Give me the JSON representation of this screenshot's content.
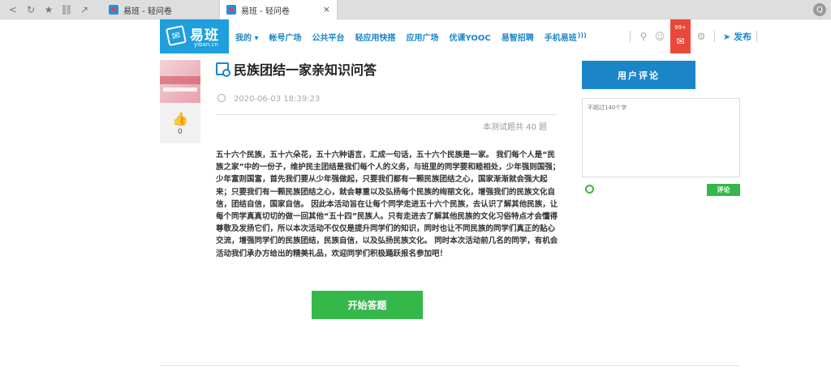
{
  "browser": {
    "tabs": [
      {
        "label": "易班 - 轻问卷"
      },
      {
        "label": "易班 - 轻问卷"
      }
    ],
    "nav_glyphs": {
      "back": "<",
      "refresh": "↻",
      "bookmark": "★",
      "link": "⛓",
      "share": "↗"
    },
    "close_glyph": "×",
    "menu_glyph": "Q"
  },
  "header": {
    "logo": {
      "name": "易班",
      "url": "yiban.cn"
    },
    "nav": [
      "我的 ▾",
      "帐号广场",
      "公共平台",
      "轻应用快搭",
      "应用广场",
      "优课YOOC",
      "易智招聘",
      "手机易班"
    ],
    "mail_badge": "99+",
    "publish_label": "发布"
  },
  "left": {
    "like_count": "0"
  },
  "main": {
    "title": "民族团结一家亲知识问答",
    "date": "2020-06-03 18:39:23",
    "question_count": "本测试题共 40 题",
    "description": "五十六个民族，五十六朵花，五十六种语言，汇成一句话，五十六个民族是一家。 我们每个人是“民族之家”中的一份子，维护民主团结是我们每个人的义务，与班里的同学要和睦相处，少年强则国强；少年富则国富，首先我们要从少年强做起，只要我们都有一颗民族团结之心，国家渐渐就会强大起来；只要我们有一颗民族团结之心，就会尊重以及弘扬每个民族的绚丽文化，增强我们的民族文化自信，团结自信，国家自信。 因此本活动旨在让每个同学走进五十六个民族，去认识了解其他民族，让每个同学真真切切的做一回其他“五十四”民族人。只有走进去了解其他民族的文化习俗特点才会懂得尊敬及发扬它们，所以本次活动不仅仅是提升同学们的知识，同时也让不同民族的同学们真正的贴心交流，增强同学们的民族团结，民族自信，以及弘扬民族文化。 同时本次活动前几名的同学，有机会活动我们承办方给出的精美礼品，欢迎同学们积极踊跃报名参加吧！",
    "start_button": "开始答题"
  },
  "comments": {
    "header": "用户评论",
    "placeholder": "不超过140个字",
    "submit": "评论"
  },
  "colors": {
    "brand_blue": "#1a86c8",
    "logo_blue": "#1f9fdc",
    "green": "#35b84a",
    "mail_red": "#e8483a"
  }
}
